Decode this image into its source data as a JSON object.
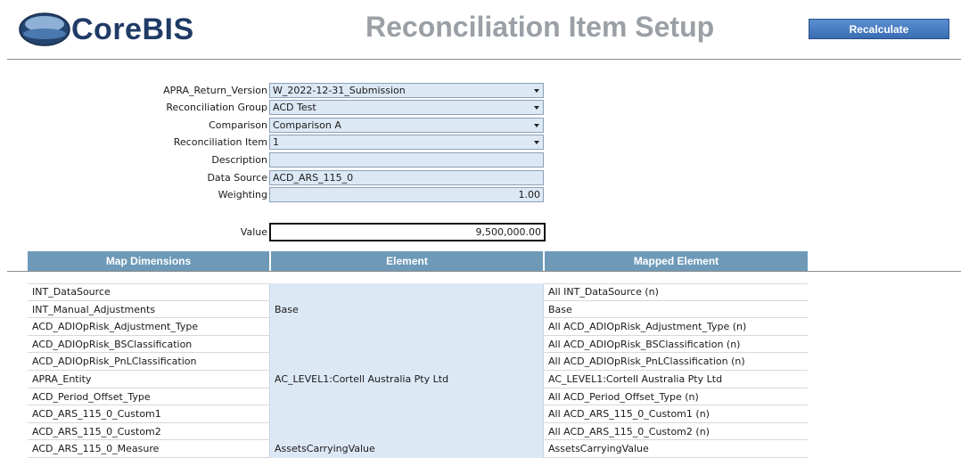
{
  "app": {
    "logo_text": "CoreBIS",
    "page_title": "Reconciliation Item Setup",
    "recalculate_label": "Recalculate"
  },
  "form": {
    "return_version": {
      "label": "APRA_Return_Version",
      "value": "W_2022-12-31_Submission"
    },
    "recon_group": {
      "label": "Reconciliation Group",
      "value": "ACD Test"
    },
    "comparison": {
      "label": "Comparison",
      "value": "Comparison A"
    },
    "recon_item": {
      "label": "Reconciliation Item",
      "value": "1"
    },
    "description": {
      "label": "Description",
      "value": ""
    },
    "data_source": {
      "label": "Data Source",
      "value": "ACD_ARS_115_0"
    },
    "weighting": {
      "label": "Weighting",
      "value": "1.00"
    },
    "value": {
      "label": "Value",
      "value": "9,500,000.00"
    }
  },
  "table": {
    "headers": [
      "Map Dimensions",
      "Element",
      "Mapped Element"
    ],
    "rows": [
      [
        "INT_DataSource",
        "",
        "All INT_DataSource (n)"
      ],
      [
        "INT_Manual_Adjustments",
        "Base",
        "Base"
      ],
      [
        "ACD_ADIOpRisk_Adjustment_Type",
        "",
        "All ACD_ADIOpRisk_Adjustment_Type (n)"
      ],
      [
        "ACD_ADIOpRisk_BSClassification",
        "",
        "All ACD_ADIOpRisk_BSClassification (n)"
      ],
      [
        "ACD_ADIOpRisk_PnLClassification",
        "",
        "All ACD_ADIOpRisk_PnLClassification (n)"
      ],
      [
        "APRA_Entity",
        "AC_LEVEL1:Cortell Australia Pty Ltd",
        "AC_LEVEL1:Cortell Australia Pty Ltd"
      ],
      [
        "ACD_Period_Offset_Type",
        "",
        "All ACD_Period_Offset_Type (n)"
      ],
      [
        "ACD_ARS_115_0_Custom1",
        "",
        "All ACD_ARS_115_0_Custom1 (n)"
      ],
      [
        "ACD_ARS_115_0_Custom2",
        "",
        "All ACD_ARS_115_0_Custom2 (n)"
      ],
      [
        "ACD_ARS_115_0_Measure",
        "AssetsCarryingValue",
        "AssetsCarryingValue"
      ]
    ]
  },
  "colors": {
    "header_blue": "#6e9ab8",
    "field_bg": "#dde8f5",
    "logo_blue": "#1f3b66"
  }
}
